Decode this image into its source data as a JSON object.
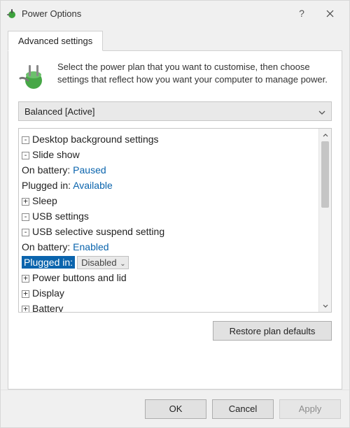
{
  "window": {
    "title": "Power Options"
  },
  "tab": {
    "label": "Advanced settings"
  },
  "intro": {
    "text": "Select the power plan that you want to customise, then choose settings that reflect how you want your computer to manage power."
  },
  "plan_dropdown": {
    "selected": "Balanced [Active]"
  },
  "tree": {
    "desktop_bg": {
      "label": "Desktop background settings"
    },
    "slideshow": {
      "label": "Slide show"
    },
    "slideshow_battery": {
      "label": "On battery:",
      "value": "Paused"
    },
    "slideshow_plugged": {
      "label": "Plugged in:",
      "value": "Available"
    },
    "sleep": {
      "label": "Sleep"
    },
    "usb": {
      "label": "USB settings"
    },
    "usb_suspend": {
      "label": "USB selective suspend setting"
    },
    "usb_suspend_battery": {
      "label": "On battery:",
      "value": "Enabled"
    },
    "usb_suspend_plugged": {
      "label": "Plugged in:",
      "value": "Disabled"
    },
    "power_buttons": {
      "label": "Power buttons and lid"
    },
    "display": {
      "label": "Display"
    },
    "battery": {
      "label": "Battery"
    }
  },
  "buttons": {
    "restore": "Restore plan defaults",
    "ok": "OK",
    "cancel": "Cancel",
    "apply": "Apply"
  }
}
